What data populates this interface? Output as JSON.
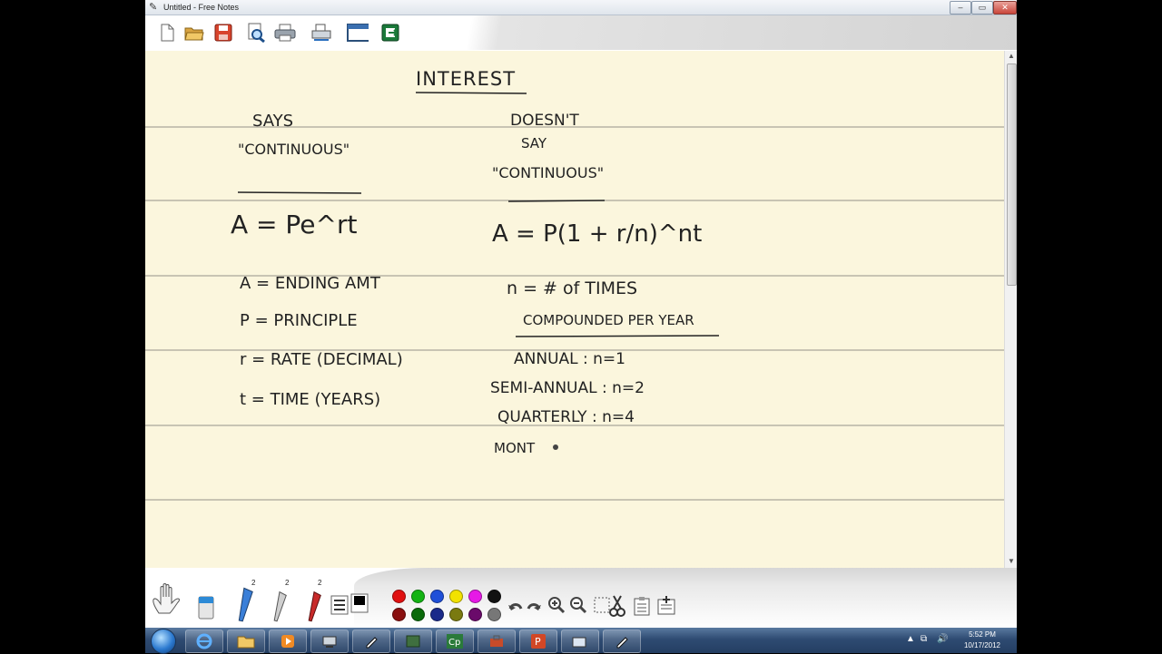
{
  "window": {
    "title": "Untitled - Free Notes",
    "min": "–",
    "max": "▭",
    "close": "✕"
  },
  "toolbar": {
    "buttons": [
      {
        "name": "new-icon"
      },
      {
        "name": "open-icon"
      },
      {
        "name": "save-icon"
      },
      {
        "name": "preview-icon"
      },
      {
        "name": "print-icon"
      },
      {
        "name": "scanner-icon"
      },
      {
        "name": "window-icon"
      },
      {
        "name": "exit-icon"
      }
    ]
  },
  "notes": {
    "heading": "INTEREST",
    "left_col": {
      "h1": "SAYS",
      "h2": "\"CONTINUOUS\"",
      "formula": "A = Pe^rt",
      "defs": [
        "A = ENDING AMT",
        "P = PRINCIPLE",
        "r = RATE (DECIMAL)",
        "t = TIME (YEARS)"
      ]
    },
    "right_col": {
      "h1": "DOESN'T",
      "h2": "SAY",
      "h3": "\"CONTINUOUS\"",
      "formula": "A = P(1 + r/n)^nt",
      "n_def": "n = # of TIMES",
      "n_def2": "COMPOUNDED PER YEAR",
      "rows": [
        "ANNUAL : n=1",
        "SEMI-ANNUAL : n=2",
        "QUARTERLY : n=4",
        "MONT"
      ]
    }
  },
  "palette": {
    "pen_numbers": [
      "2",
      "2",
      "2"
    ],
    "colors": [
      "#e01010",
      "#13b313",
      "#1f4fd8",
      "#f2e200",
      "#e619e6",
      "#111111",
      "#8a1010",
      "#0a6a0a",
      "#1a2a8a",
      "#7a7a10",
      "#6a0a6a",
      "#777777"
    ]
  },
  "taskbar": {
    "time": "5:52 PM",
    "date": "10/17/2012"
  }
}
